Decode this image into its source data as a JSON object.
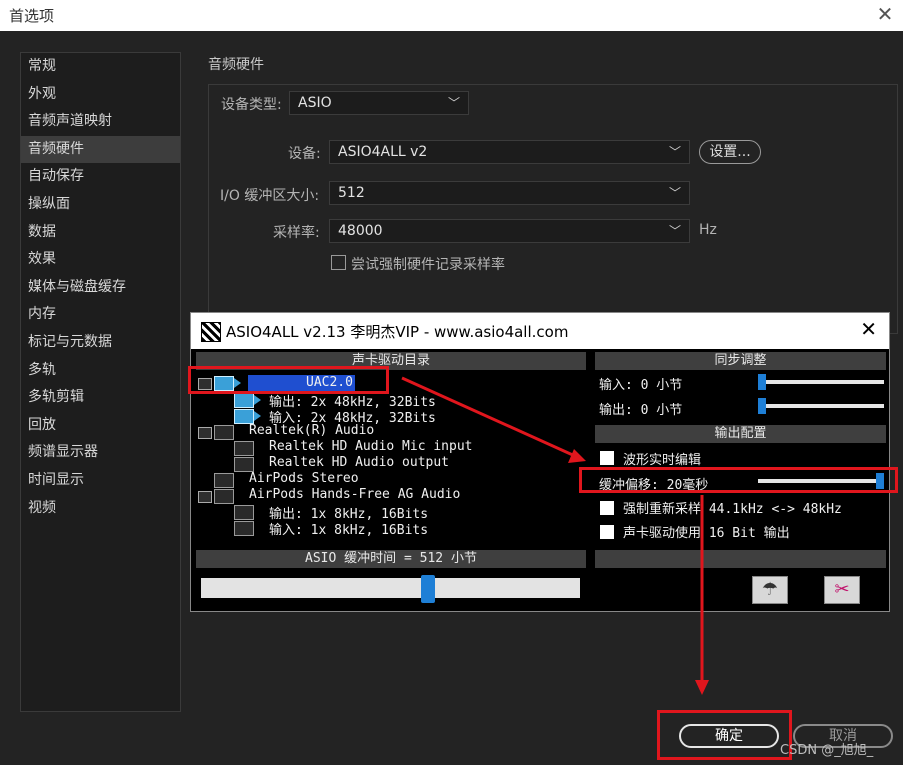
{
  "window": {
    "title": "首选项"
  },
  "sidebar": {
    "items": [
      {
        "label": "常规"
      },
      {
        "label": "外观"
      },
      {
        "label": "音频声道映射"
      },
      {
        "label": "音频硬件"
      },
      {
        "label": "自动保存"
      },
      {
        "label": "操纵面"
      },
      {
        "label": "数据"
      },
      {
        "label": "效果"
      },
      {
        "label": "媒体与磁盘缓存"
      },
      {
        "label": "内存"
      },
      {
        "label": "标记与元数据"
      },
      {
        "label": "多轨"
      },
      {
        "label": "多轨剪辑"
      },
      {
        "label": "回放"
      },
      {
        "label": "频谱显示器"
      },
      {
        "label": "时间显示"
      },
      {
        "label": "视频"
      }
    ],
    "selected": "音频硬件"
  },
  "main": {
    "section_title": "音频硬件",
    "device_type_label": "设备类型:",
    "device_type_value": "ASIO",
    "device_label": "设备:",
    "device_value": "ASIO4ALL v2",
    "settings_button": "设置...",
    "buffer_label": "I/O 缓冲区大小:",
    "buffer_value": "512",
    "sample_rate_label": "采样率:",
    "sample_rate_value": "48000",
    "sample_rate_unit": "Hz",
    "force_checkbox_label": "尝试强制硬件记录采样率",
    "force_checked": false
  },
  "asio": {
    "title": "ASIO4ALL v2.13 李明杰VIP - www.asio4all.com",
    "driver_list_header": "声卡驱动目录",
    "tree": [
      {
        "label": "UAC2.0",
        "selected": true
      },
      {
        "label": "输出: 2x 48kHz, 32Bits"
      },
      {
        "label": "输入: 2x 48kHz, 32Bits"
      },
      {
        "label": "Realtek(R) Audio"
      },
      {
        "label": "Realtek HD Audio Mic input"
      },
      {
        "label": "Realtek HD Audio output"
      },
      {
        "label": "AirPods Stereo"
      },
      {
        "label": "AirPods Hands-Free AG Audio"
      },
      {
        "label": "输出: 1x 8kHz, 16Bits"
      },
      {
        "label": "输入: 1x 8kHz, 16Bits"
      }
    ],
    "buffer_text": "ASIO 缓冲时间 = 512 小节",
    "buffer_slider_level": 0.6,
    "sync_header": "同步调整",
    "input_sync": "输入: 0 小节",
    "output_sync": "输出: 0 小节",
    "output_config_header": "输出配置",
    "realtime_edit": "波形实时编辑",
    "buffer_offset": "缓冲偏移: 20毫秒",
    "force_resample": "强制重新采样 44.1kHz <-> 48kHz",
    "driver_16bit": "声卡驱动使用 16 Bit 输出",
    "icon_left": "parachute-icon",
    "icon_right": "tools-icon"
  },
  "footer": {
    "ok": "确定",
    "cancel": "取消",
    "watermark": "CSDN @_旭旭_"
  },
  "colors": {
    "annotation": "#e0161d",
    "slider": "#1e7fd6"
  }
}
